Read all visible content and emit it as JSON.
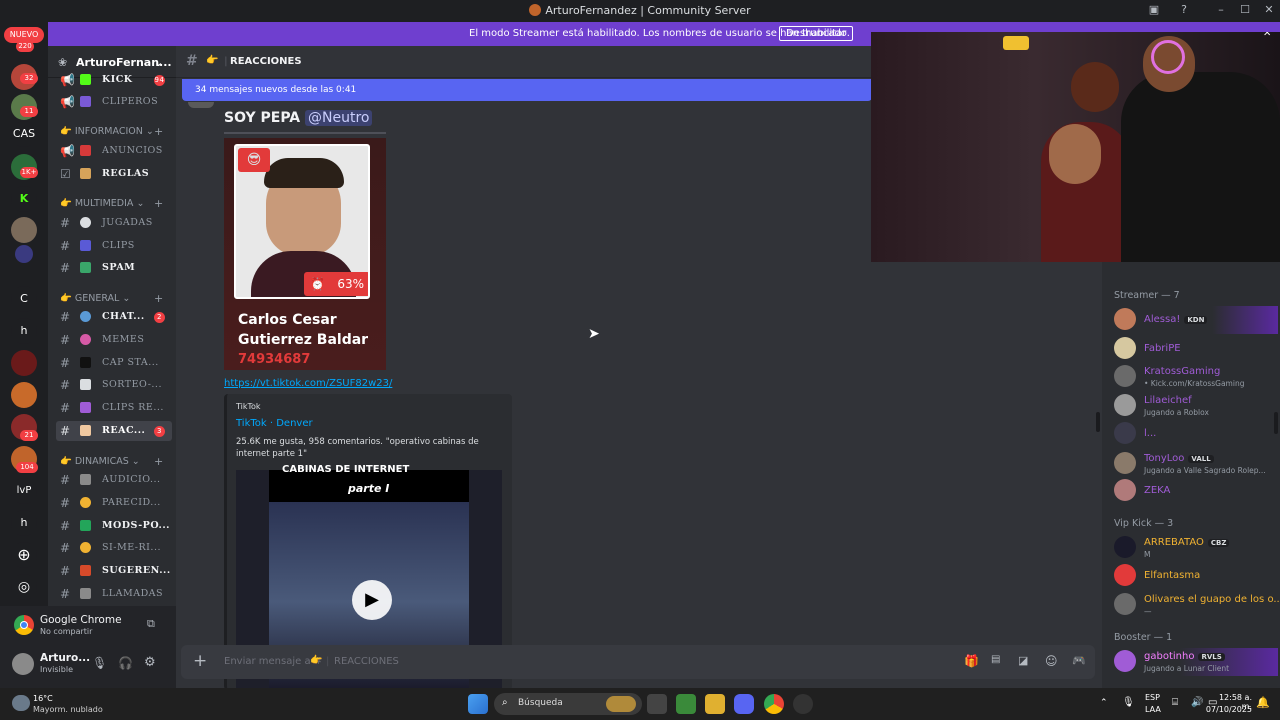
{
  "window": {
    "title": "ArturoFernandez | Community Server"
  },
  "streamer_bar": {
    "text": "El modo Streamer está habilitado. Los nombres de usuario se han truncado.",
    "button": "Deshabilitar"
  },
  "guilds": {
    "new_label": "NUEVO",
    "new_count": "220",
    "items": [
      {
        "label": "",
        "badge": "32"
      },
      {
        "label": "",
        "badge": "11"
      },
      {
        "label": "CAS",
        "badge": ""
      },
      {
        "label": "",
        "badge": "1K+"
      },
      {
        "label": "K",
        "badge": ""
      },
      {
        "label": "",
        "badge": ""
      },
      {
        "label": "",
        "badge": ""
      },
      {
        "label": "C",
        "badge": ""
      },
      {
        "label": "h",
        "badge": ""
      },
      {
        "label": "",
        "badge": ""
      },
      {
        "label": "",
        "badge": ""
      },
      {
        "label": "",
        "badge": "21"
      },
      {
        "label": "",
        "badge": "104"
      },
      {
        "label": "lvP",
        "badge": ""
      },
      {
        "label": "h",
        "badge": ""
      }
    ]
  },
  "server": {
    "name": "ArturoFernan..."
  },
  "categories": {
    "informacion": "INFORMACION",
    "multimedia": "MULTIMEDIA",
    "general": "GENERAL",
    "dinamicas": "DINAMICAS"
  },
  "channels": [
    {
      "name": "KICK",
      "badge": "94"
    },
    {
      "name": "CLIPEROS",
      "badge": ""
    },
    {
      "name": "ANUNCIOS",
      "badge": ""
    },
    {
      "name": "REGLAS",
      "badge": ""
    },
    {
      "name": "JUGADAS",
      "badge": ""
    },
    {
      "name": "CLIPS",
      "badge": ""
    },
    {
      "name": "SPAM",
      "badge": ""
    },
    {
      "name": "CHAT...",
      "badge": "2"
    },
    {
      "name": "MEMES",
      "badge": ""
    },
    {
      "name": "CAP STA...",
      "badge": ""
    },
    {
      "name": "SORTEO-...",
      "badge": ""
    },
    {
      "name": "CLIPS RE...",
      "badge": ""
    },
    {
      "name": "REAC...",
      "badge": "3"
    },
    {
      "name": "AUDICIO...",
      "badge": ""
    },
    {
      "name": "PARECID...",
      "badge": ""
    },
    {
      "name": "MODS-PO...",
      "badge": ""
    },
    {
      "name": "SI-ME-RI...",
      "badge": ""
    },
    {
      "name": "SUGEREN...",
      "badge": ""
    },
    {
      "name": "LLAMADAS",
      "badge": ""
    }
  ],
  "activity": {
    "app": "Google Chrome",
    "status": "No compartir"
  },
  "user": {
    "name": "Arturo...",
    "status": "Invisible"
  },
  "chat": {
    "channel": "REACCIONES",
    "new_messages": "34 mensajes nuevos desde las 0:41",
    "message_title": "SOY PEPA",
    "mention": "@Neutro",
    "card": {
      "percent": "63%",
      "name_line1": "Carlos Cesar",
      "name_line2": "Gutierrez Baldar",
      "number": "74934687"
    },
    "link": "https://vt.tiktok.com/ZSUF82w23/",
    "embed": {
      "provider": "TikTok",
      "title": "TikTok · Denver",
      "description": "25.6K me gusta, 958 comentarios. \"operativo cabinas de internet parte 1\"",
      "video_caption_1": "CABINAS DE INTERNET",
      "video_caption_2": "parte I"
    },
    "composer_placeholder": "Enviar mensaje a #",
    "composer_channel": "REACCIONES"
  },
  "members": {
    "groups": [
      {
        "title": "Streamer — 7",
        "items": [
          {
            "name": "Alessa!",
            "tag": "KDN",
            "status": "",
            "color": "#a05cd6"
          },
          {
            "name": "FabriPE",
            "tag": "",
            "status": "",
            "color": "#a05cd6"
          },
          {
            "name": "KratossGaming",
            "tag": "",
            "status": "• Kick.com/KratossGaming",
            "color": "#a05cd6"
          },
          {
            "name": "Lilaeichef",
            "tag": "",
            "status": "Jugando a Roblox",
            "color": "#a05cd6"
          },
          {
            "name": "l...",
            "tag": "",
            "status": "",
            "color": "#a05cd6"
          },
          {
            "name": "TonyLoo",
            "tag": "VALL",
            "status": "Jugando a Valle Sagrado Rolep...",
            "color": "#a05cd6"
          },
          {
            "name": "ZEKA",
            "tag": "",
            "status": "",
            "color": "#a05cd6"
          }
        ]
      },
      {
        "title": "Vip Kick — 3",
        "items": [
          {
            "name": "ARREBATAO",
            "tag": "CBZ",
            "status": "M",
            "color": "#f0b232"
          },
          {
            "name": "Elfantasma",
            "tag": "",
            "status": "",
            "color": "#f0b232"
          },
          {
            "name": "Olivares el guapo de los o...",
            "tag": "",
            "status": "—",
            "color": "#f0b232"
          }
        ]
      },
      {
        "title": "Booster — 1",
        "items": [
          {
            "name": "gabotinho",
            "tag": "RVLS",
            "status": "Jugando a Lunar Client",
            "color": "#f47fff"
          }
        ]
      }
    ]
  },
  "taskbar": {
    "weather_temp": "16°C",
    "weather_desc": "Mayorm. nublado",
    "search": "Búsqueda",
    "lang_1": "ESP",
    "lang_2": "LAA",
    "time": "12:58 a. m.",
    "date": "07/10/2025"
  }
}
